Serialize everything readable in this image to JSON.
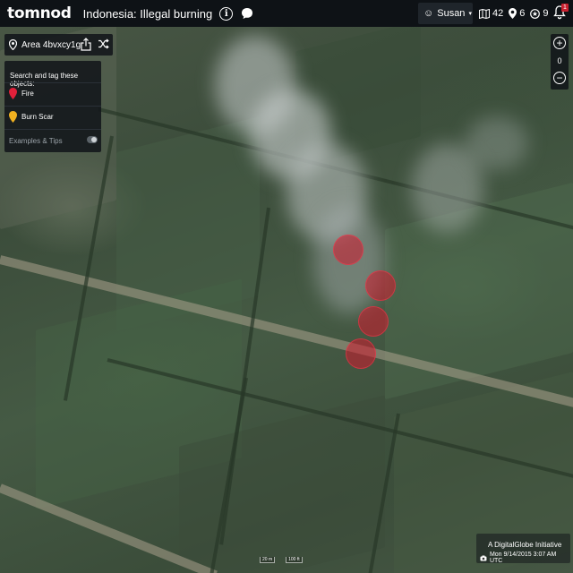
{
  "topbar": {
    "logo": "tomnod",
    "campaign_title": "Indonesia: Illegal burning",
    "info_glyph": "i",
    "user": {
      "name": "Susan",
      "caret": "▾"
    },
    "stats": [
      {
        "icon": "map-icon",
        "value": "42"
      },
      {
        "icon": "map-pin-icon",
        "value": "6"
      },
      {
        "icon": "badge-icon",
        "value": "9"
      }
    ],
    "notification_count": "1"
  },
  "area_panel": {
    "area_label": "Area 4bvxcy1g"
  },
  "tag_panel": {
    "instruction": "Search and tag these objects:",
    "options": [
      {
        "label": "Fire",
        "color": "#e2203a",
        "icon": "red-map-pin-icon"
      },
      {
        "label": "Burn Scar",
        "color": "#f0b020",
        "icon": "yellow-map-pin-icon"
      }
    ],
    "tips_label": "Examples & Tips"
  },
  "zoom": {
    "level": "0",
    "zoom_in_glyph": "+",
    "zoom_out_glyph": "−"
  },
  "map": {
    "fire_tags_count": 4,
    "tag_color": "#d2192d"
  },
  "scale_bar": {
    "metric": "20 m",
    "imperial": "100 ft"
  },
  "credit": {
    "provider": "A DigitalGlobe Initiative",
    "capture_date": "Mon 9/14/2015 3:07 AM UTC"
  }
}
